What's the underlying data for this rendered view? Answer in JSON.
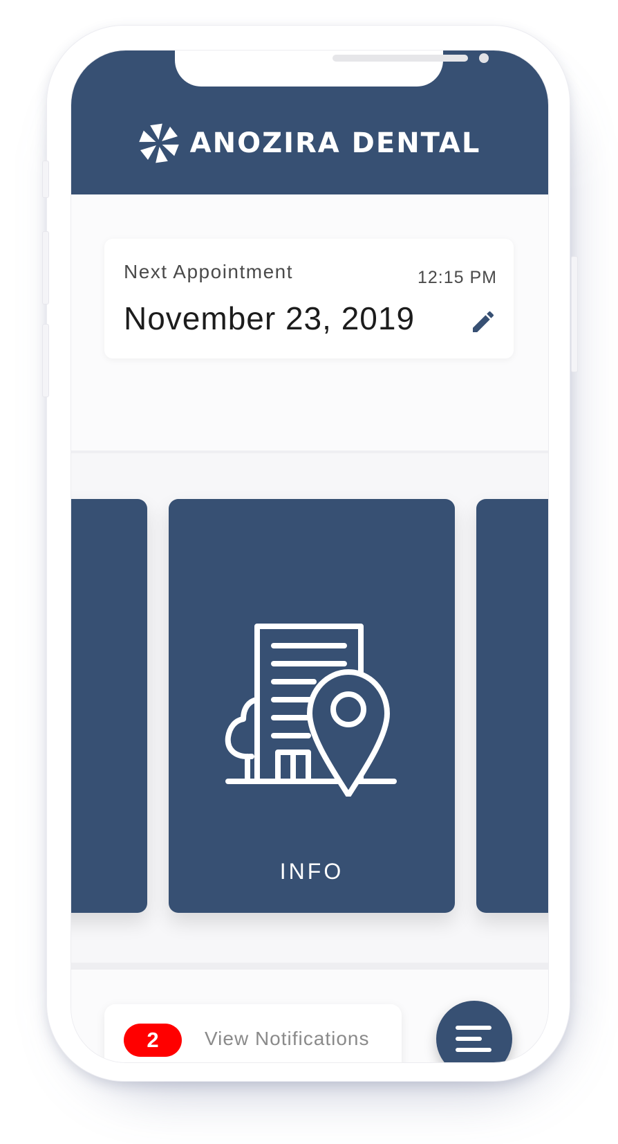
{
  "header": {
    "logo_icon": "pinwheel-logo-icon",
    "brand_name": "ANOZIRA DENTAL"
  },
  "appointment": {
    "label": "Next Appointment",
    "time": "12:15 PM",
    "date": "November 23, 2019",
    "edit_icon": "pencil-icon"
  },
  "carousel": {
    "items": [
      {
        "label": "",
        "icon": ""
      },
      {
        "label": "INFO",
        "icon": "building-location-icon"
      },
      {
        "label": "",
        "icon": ""
      }
    ]
  },
  "bottom_bar": {
    "notification_count": "2",
    "notification_label": "View Notifications",
    "menu_icon": "menu-lines-icon"
  },
  "colors": {
    "brand": "#375073",
    "badge": "#ff0000",
    "background": "#ffffff"
  }
}
